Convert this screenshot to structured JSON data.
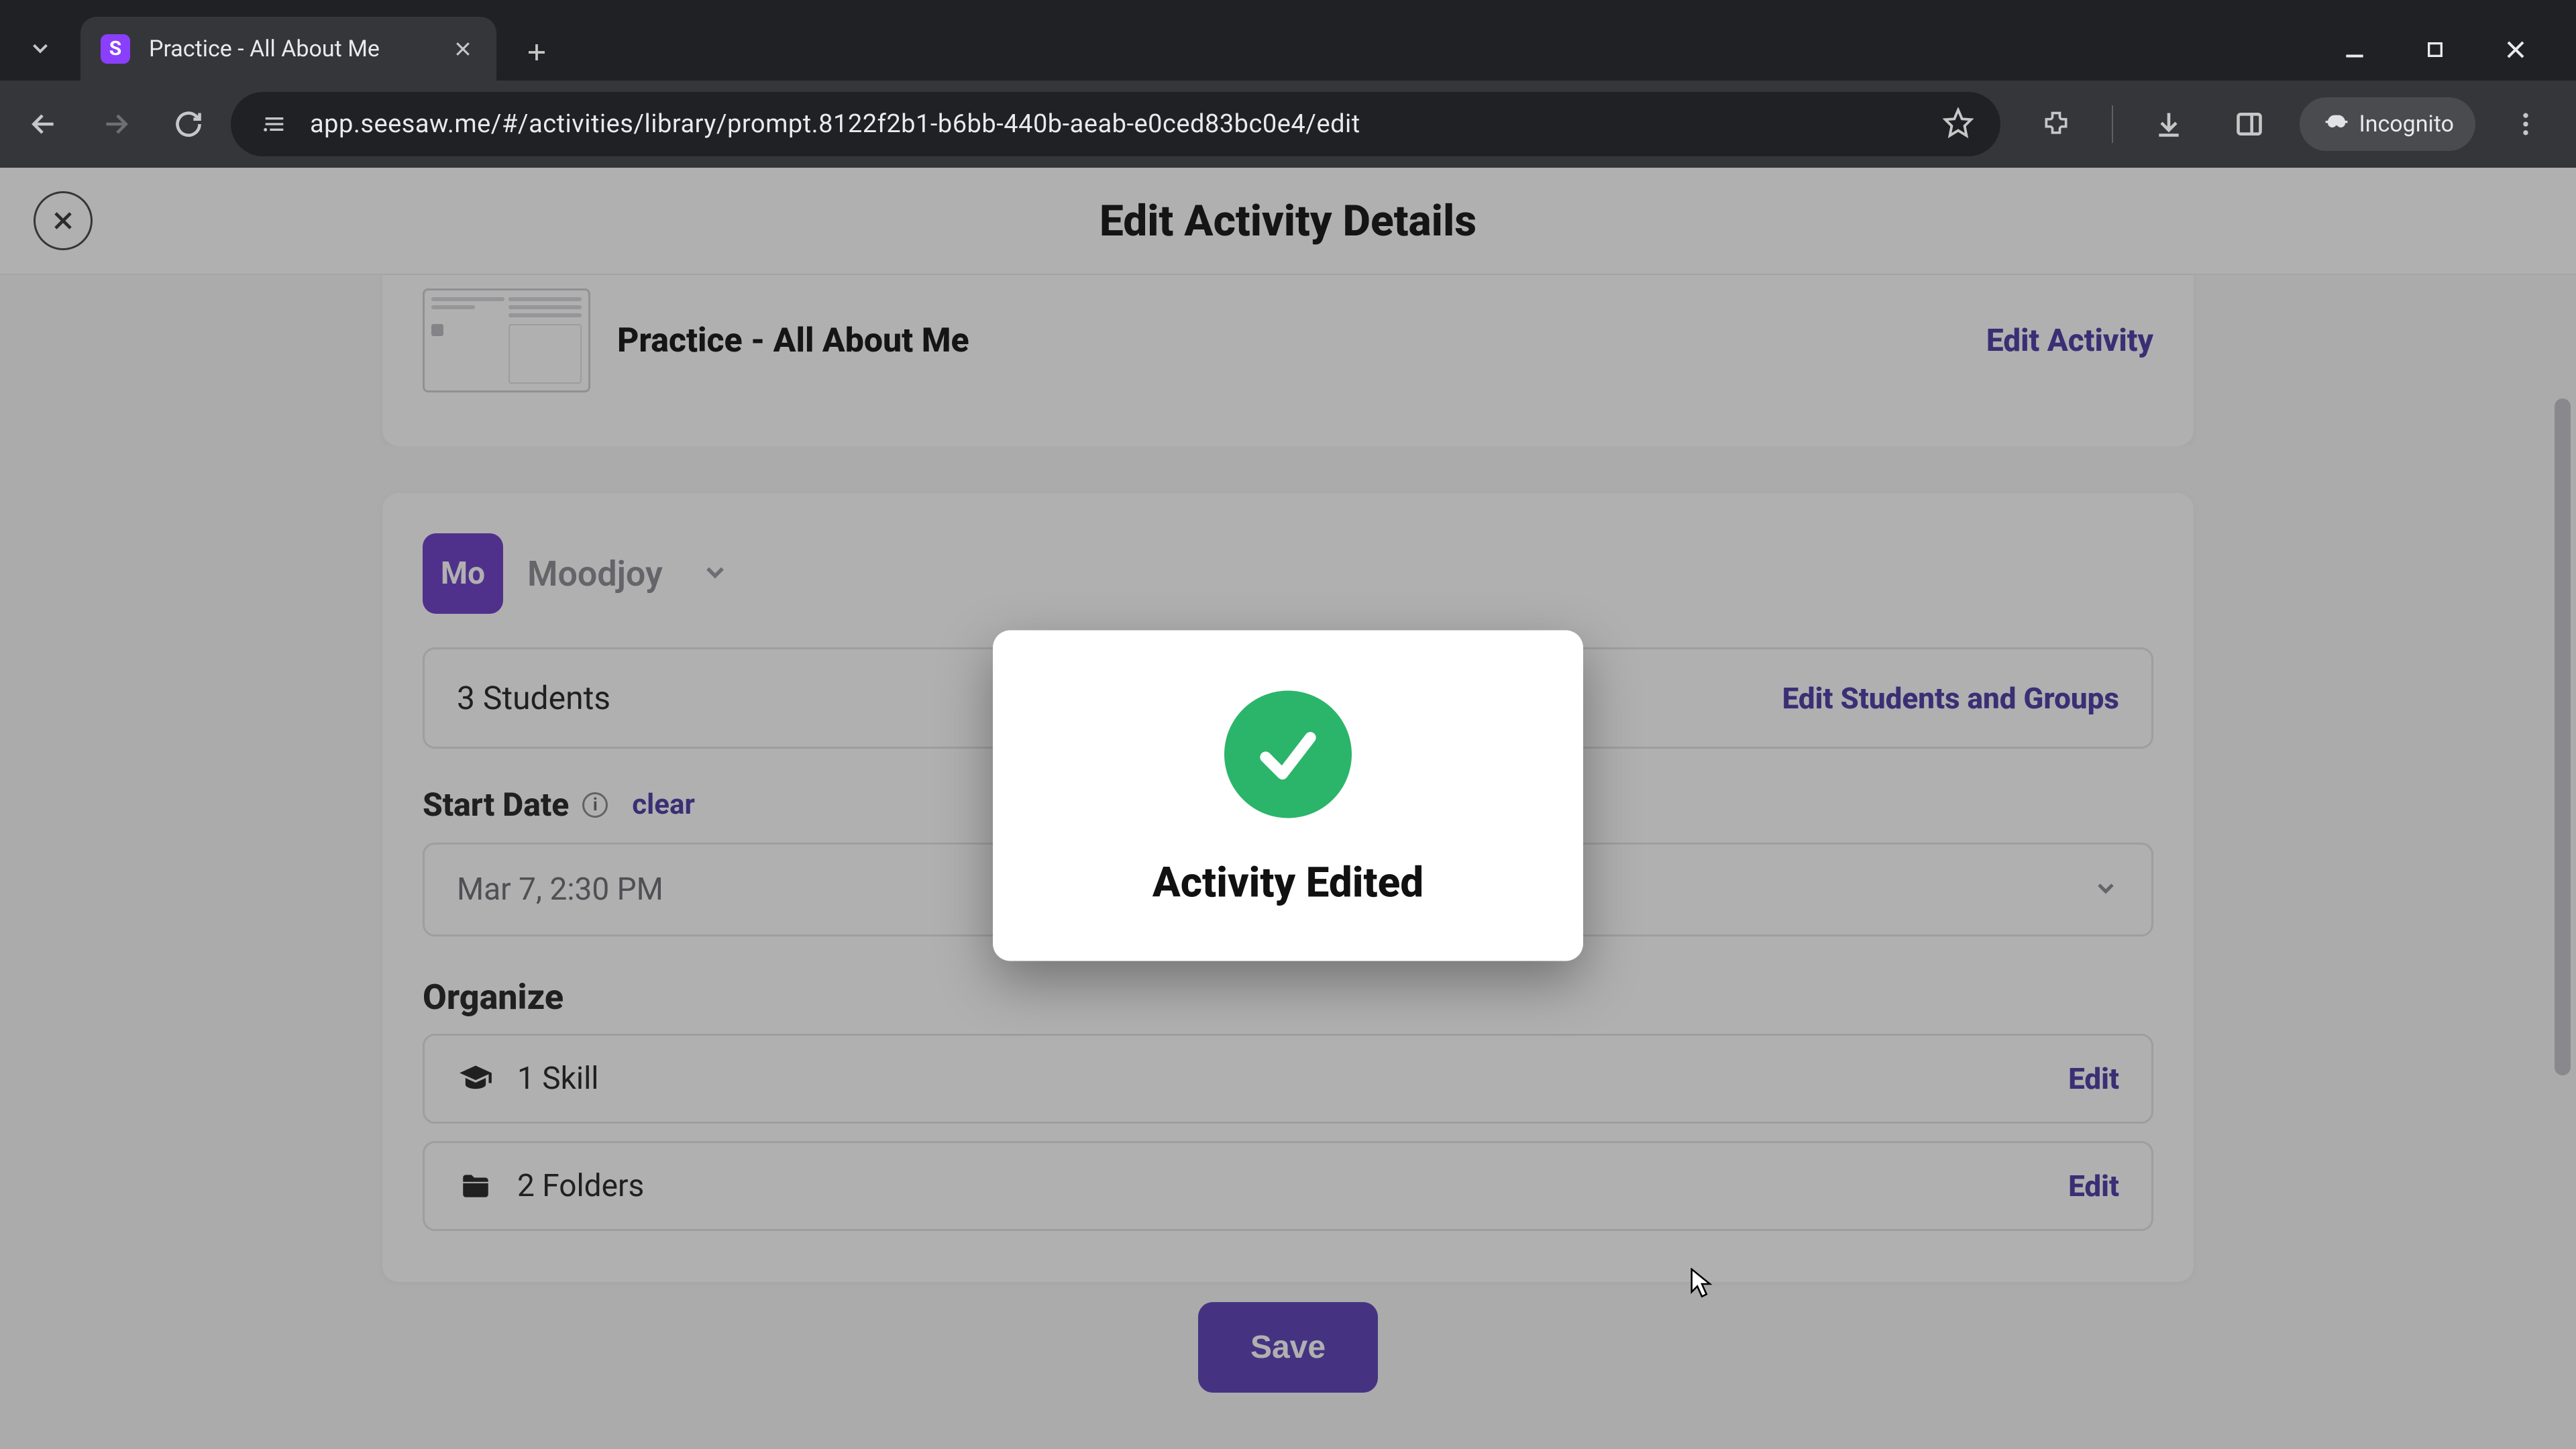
{
  "browser": {
    "tab_title": "Practice - All About Me",
    "favicon_letter": "S",
    "url": "app.seesaw.me/#/activities/library/prompt.8122f2b1-b6bb-440b-aeab-e0ced83bc0e4/edit",
    "incognito_label": "Incognito"
  },
  "page": {
    "header_title": "Edit Activity Details",
    "activity": {
      "title": "Practice - All About Me",
      "edit_link": "Edit Activity"
    },
    "class": {
      "avatar_initials": "Mo",
      "name": "Moodjoy"
    },
    "students_row": {
      "count_text": "3 Students",
      "link": "Edit Students and Groups"
    },
    "start_date": {
      "label": "Start Date",
      "clear": "clear",
      "value": "Mar 7, 2:30 PM"
    },
    "organize": {
      "label": "Organize",
      "rows": [
        {
          "icon": "graduation-cap-icon",
          "text": "1 Skill",
          "edit": "Edit"
        },
        {
          "icon": "folder-icon",
          "text": "2 Folders",
          "edit": "Edit"
        }
      ]
    },
    "save_label": "Save"
  },
  "modal": {
    "title": "Activity Edited"
  },
  "colors": {
    "accent": "#5b3fb8",
    "link": "#4b3aa5",
    "success": "#2bb56a",
    "class_avatar": "#6a3cc8"
  }
}
